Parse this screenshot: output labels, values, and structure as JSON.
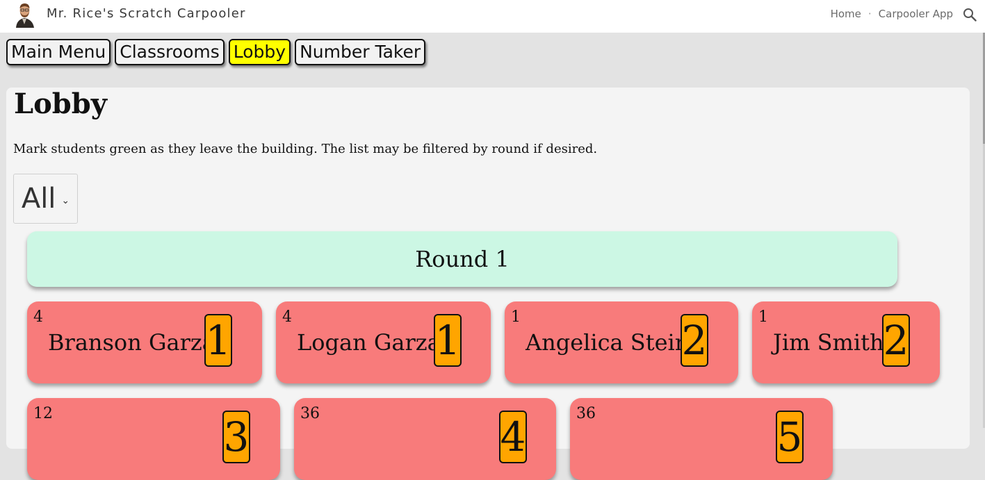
{
  "header": {
    "site_title": "Mr. Rice's Scratch Carpooler",
    "nav": [
      "Home",
      "Carpooler App"
    ],
    "separator": "·",
    "icons": [
      "avatar",
      "search-icon"
    ]
  },
  "tabs": [
    {
      "label": "Main Menu",
      "active": false
    },
    {
      "label": "Classrooms",
      "active": false
    },
    {
      "label": "Lobby",
      "active": true
    },
    {
      "label": "Number Taker",
      "active": false
    }
  ],
  "main": {
    "title": "Lobby",
    "instructions": "Mark students green as they leave the building. The list may be filtered by round if desired.",
    "round_filter": {
      "selected": "All"
    },
    "round_header": "Round 1",
    "students": [
      {
        "room": "4",
        "name": "Branson Garza",
        "number": "1"
      },
      {
        "room": "4",
        "name": "Logan Garza",
        "number": "1"
      },
      {
        "room": "1",
        "name": "Angelica Stein",
        "number": "2"
      },
      {
        "room": "1",
        "name": "Jim Smith",
        "number": "2"
      },
      {
        "room": "12",
        "name": "",
        "number": "3"
      },
      {
        "room": "36",
        "name": "",
        "number": "4"
      },
      {
        "room": "36",
        "name": "",
        "number": "5"
      }
    ]
  },
  "colors": {
    "active_tab": "#ffff00",
    "round_header_bg": "#ccf7e4",
    "student_card_bg": "#f87b7b",
    "car_number_bg": "#ffa500"
  }
}
